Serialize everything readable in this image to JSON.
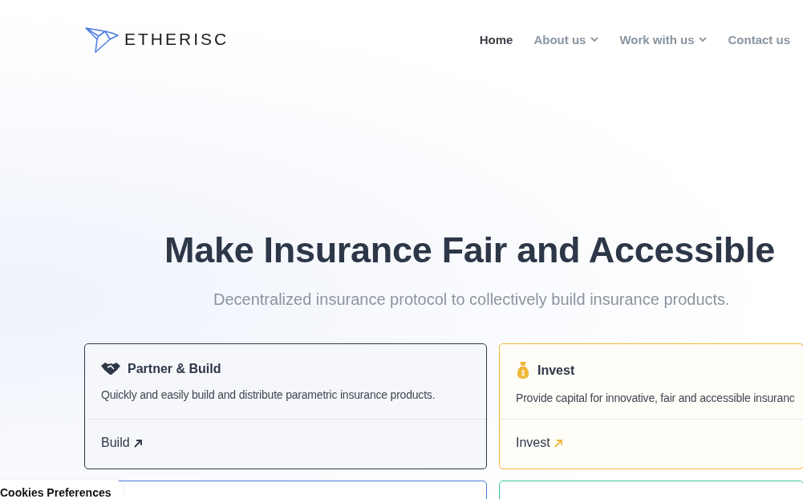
{
  "brand": {
    "name": "ETHERISC"
  },
  "nav": [
    {
      "label": "Home",
      "selected": true,
      "dropdown": false
    },
    {
      "label": "About us",
      "selected": false,
      "dropdown": true
    },
    {
      "label": "Work with us",
      "selected": false,
      "dropdown": true
    },
    {
      "label": "Contact us",
      "selected": false,
      "dropdown": false
    }
  ],
  "hero": {
    "title": "Make Insurance Fair and Accessible",
    "subtitle": "Decentralized insurance protocol to collectively build insurance products."
  },
  "cards": [
    {
      "kind": "handshake",
      "title": "Partner & Build",
      "description": "Quickly and easily build and distribute parametric insurance products.",
      "link": "Build",
      "color": "#2d3748"
    },
    {
      "kind": "moneybag",
      "title": "Invest",
      "description": "Provide capital for innovative, fair and accessible insuranc",
      "link": "Invest",
      "color": "#f0b83a"
    }
  ],
  "more_cards": [
    {
      "color": "#4a7bd0"
    },
    {
      "color": "#3cc9a0"
    }
  ],
  "cookie_tab": {
    "label": "Cookies Preferences"
  }
}
